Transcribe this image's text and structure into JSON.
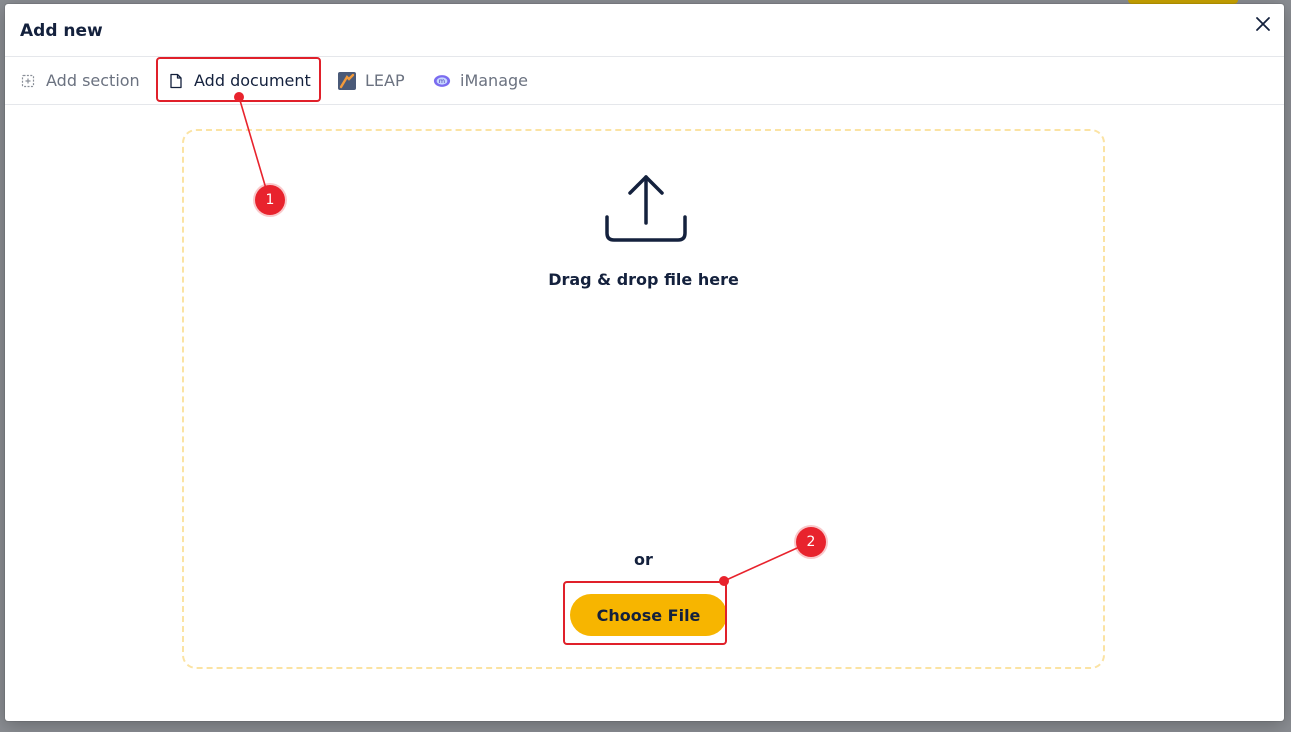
{
  "modal": {
    "title": "Add new",
    "close_icon": "close-icon"
  },
  "tabs": [
    {
      "label": "Add section",
      "icon": "add-section-icon"
    },
    {
      "label": "Add document",
      "icon": "document-icon",
      "active": true
    },
    {
      "label": "LEAP",
      "icon": "leap-logo-icon"
    },
    {
      "label": "iManage",
      "icon": "imanage-logo-icon"
    }
  ],
  "dropzone": {
    "icon": "upload-icon",
    "drag_text": "Drag & drop file here",
    "or_text": "or",
    "choose_label": "Choose File"
  },
  "annotations": {
    "markers": [
      "1",
      "2"
    ]
  },
  "colors": {
    "accent": "#f7b500",
    "text": "#14213d",
    "annotation": "#e8232d",
    "dropzone_border": "#fbe3a3"
  }
}
